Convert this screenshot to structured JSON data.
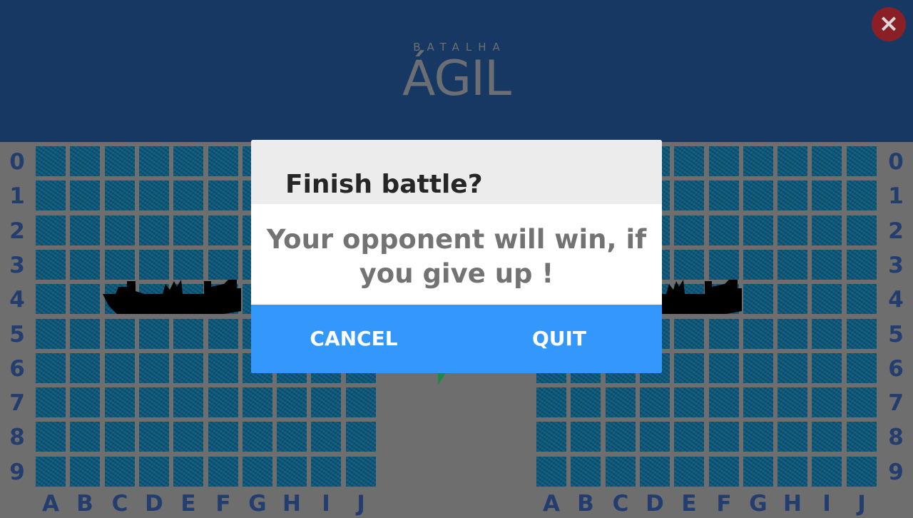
{
  "header": {
    "logo_top": "BATALHA",
    "logo_main": "ÁGIL",
    "close_icon": "×"
  },
  "boards": {
    "row_labels": [
      "0",
      "1",
      "2",
      "3",
      "4",
      "5",
      "6",
      "7",
      "8",
      "9"
    ],
    "col_labels": [
      "A",
      "B",
      "C",
      "D",
      "E",
      "F",
      "G",
      "H",
      "I",
      "J"
    ]
  },
  "dialog": {
    "title": "Finish battle?",
    "message": "Your opponent will win, if you give up !",
    "cancel_label": "CANCEL",
    "quit_label": "QUIT"
  },
  "colors": {
    "header": "#163863",
    "background": "#6e6e6e",
    "label": "#223d6e",
    "button_bar": "#3497fb",
    "close": "#8a1f26"
  }
}
